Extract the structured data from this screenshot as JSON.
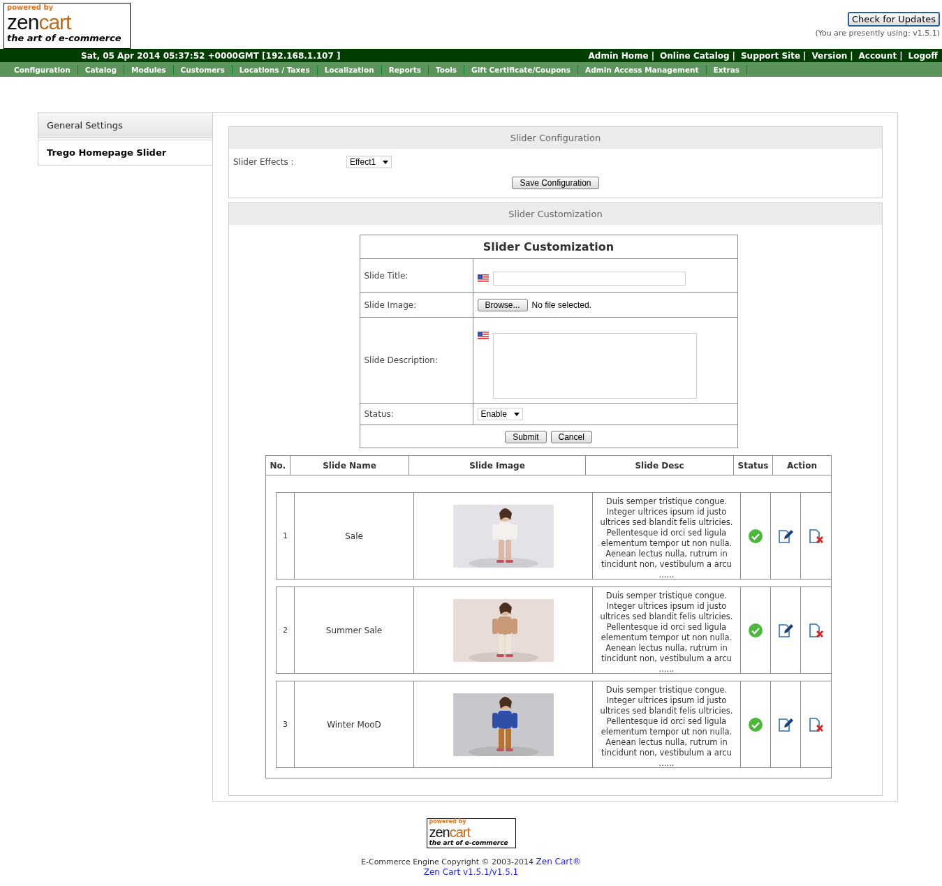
{
  "logo": {
    "powered_by": "powered by",
    "zen": "zen",
    "cart": "cart",
    "tagline": "the art of e-commerce"
  },
  "header": {
    "button": "Check for Updates",
    "version_note": "(You are presently using: v1.5.1)"
  },
  "top_bar": {
    "datetime": "Sat, 05 Apr 2014 05:37:52 +0000GMT [192.168.1.107 ]",
    "separator": "|",
    "links": [
      "Admin Home",
      "Online Catalog",
      "Support Site",
      "Version",
      "Account",
      "Logoff"
    ]
  },
  "menu": [
    "Configuration",
    "Catalog",
    "Modules",
    "Customers",
    "Locations / Taxes",
    "Localization",
    "Reports",
    "Tools",
    "Gift Certificate/Coupons",
    "Admin Access Management",
    "Extras"
  ],
  "side_tabs": [
    {
      "label": "General Settings",
      "selected": false
    },
    {
      "label": "Trego Homepage Slider",
      "selected": true
    }
  ],
  "config": {
    "title": "Slider Configuration",
    "effects_label": "Slider Effects :",
    "effects_value": "Effect1",
    "save_button": "Save Configuration"
  },
  "customization": {
    "title": "Slider Customization",
    "form_title": "Slider Customization",
    "fields": [
      {
        "kind": "text",
        "label": "Slide Title:"
      },
      {
        "kind": "file",
        "label": "Slide Image:",
        "button": "Browse...",
        "note": "No file selected."
      },
      {
        "kind": "textarea",
        "label": "Slide Description:"
      },
      {
        "kind": "select",
        "label": "Status:",
        "value": "Enable"
      }
    ],
    "buttons": [
      "Submit",
      "Cancel"
    ]
  },
  "slides": {
    "columns": [
      "No.",
      "Slide Name",
      "Slide Image",
      "Slide Desc",
      "Status",
      "Action"
    ],
    "rows": [
      {
        "no": "1",
        "name": "Sale",
        "desc": "Duis semper tristique congue. Integer ultrices ipsum id justo ultrices sed blandit felis ultricies. Pellentesque id orci sed ligula elementum tempor ut non nulla. Aenean lectus nulla, rutrum in tincidunt non, vestibulum a arcu",
        "more": "......",
        "enabled": true
      },
      {
        "no": "2",
        "name": "Summer Sale",
        "desc": "Duis semper tristique congue. Integer ultrices ipsum id justo ultrices sed blandit felis ultricies. Pellentesque id orci sed ligula elementum tempor ut non nulla. Aenean lectus nulla, rutrum in tincidunt non, vestibulum a arcu",
        "more": "......",
        "enabled": true
      },
      {
        "no": "3",
        "name": "Winter MooD",
        "desc": "Duis semper tristique congue. Integer ultrices ipsum id justo ultrices sed blandit felis ultricies. Pellentesque id orci sed ligula elementum tempor ut non nulla. Aenean lectus nulla, rutrum in tincidunt non, vestibulum a arcu",
        "more": "......",
        "enabled": true
      }
    ]
  },
  "footer": {
    "logo": {
      "powered_by": "powered by",
      "zen": "zen",
      "cart": "cart",
      "tagline": "the art of e-commerce"
    },
    "copyright": "E-Commerce Engine Copyright © 2003-2014",
    "copyright_link": "Zen Cart®",
    "version_link": "Zen Cart v1.5.1/v1.5.1"
  }
}
